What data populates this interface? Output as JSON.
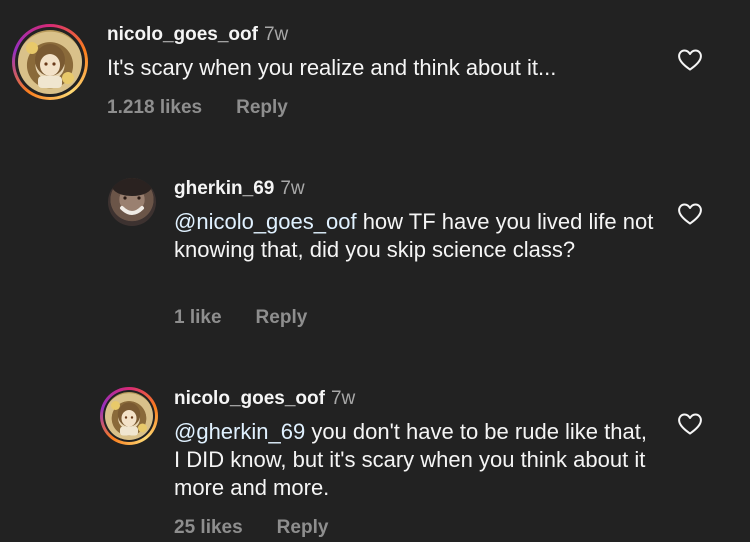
{
  "comments": [
    {
      "username": "nicolo_goes_oof",
      "time": "7w",
      "text": "It's scary when you realize and think about it...",
      "likes": "1.218 likes",
      "reply_label": "Reply"
    },
    {
      "username": "gherkin_69",
      "time": "7w",
      "mention": "@nicolo_goes_oof",
      "text": " how TF have you lived life not knowing that, did you skip science class?",
      "likes": "1 like",
      "reply_label": "Reply"
    },
    {
      "username": "nicolo_goes_oof",
      "time": "7w",
      "mention": "@gherkin_69",
      "text": " you don't have to be rude like that, I DID know, but it's scary when you think about it more and more.",
      "likes": "25 likes",
      "reply_label": "Reply"
    }
  ],
  "colors": {
    "background": "#222222",
    "text": "#f5f5f5",
    "muted": "#8e8e8e",
    "story_ring": "#fa7e1e"
  },
  "icons": {
    "like": "heart-outline-icon"
  }
}
